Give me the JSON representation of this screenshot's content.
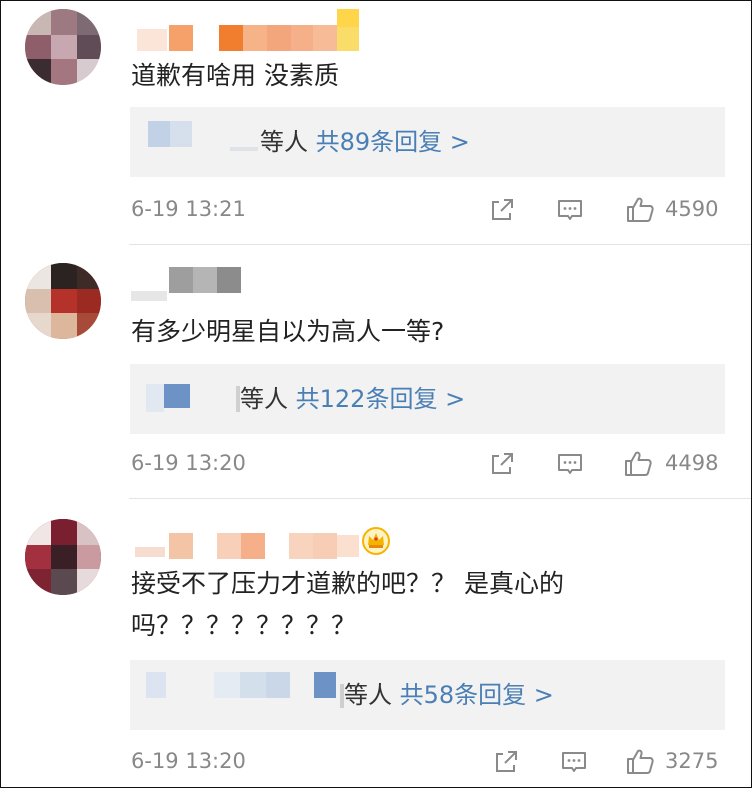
{
  "comments": [
    {
      "text": "道歉有啥用 没素质",
      "reply_suffix": "等人",
      "reply_link": "共89条回复 >",
      "time": "6-19 13:21",
      "likes": "4590"
    },
    {
      "text": "有多少明星自以为高人一等?",
      "reply_suffix": "等人",
      "reply_link": "共122条回复 >",
      "time": "6-19 13:20",
      "likes": "4498"
    },
    {
      "text_line1": "接受不了压力才道歉的吧？？ 是真心的",
      "text_line2": "吗？？？？？？？？",
      "reply_suffix": "等人",
      "reply_link": "共58条回复 >",
      "time": "6-19 13:20",
      "likes": "3275"
    }
  ],
  "icons": [
    "share-icon",
    "comment-icon",
    "like-icon"
  ],
  "colors": {
    "link": "#4a7fb5",
    "meta": "#888888",
    "reply_bg": "#f2f2f2"
  }
}
